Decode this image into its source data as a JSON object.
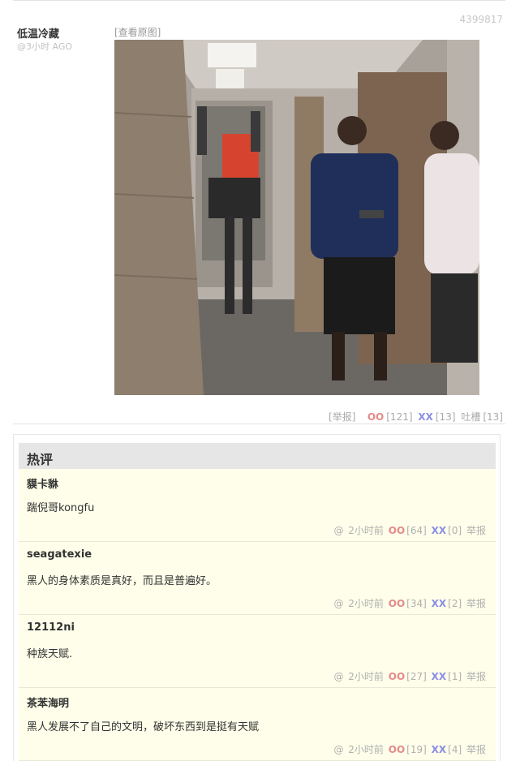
{
  "post": {
    "id": "4399817",
    "author": "低温冷藏",
    "time": "@3小时 AGO",
    "view_original": "[查看原图]",
    "report": "[举报]",
    "oo_label": "OO",
    "oo_count": "[121]",
    "xx_label": "XX",
    "xx_count": "[13]",
    "tucao_label": "吐槽",
    "tucao_count": "[13]"
  },
  "hot_comments": {
    "title": "热评",
    "items": [
      {
        "author": "貘卡貅",
        "text": "踹倪哥kongfu",
        "at": "@",
        "time": "2小时前",
        "oo": "OO",
        "oo_count": "[64]",
        "xx": "XX",
        "xx_count": "[0]",
        "report": "举报"
      },
      {
        "author": "seagatexie",
        "text": "黑人的身体素质是真好，而且是普遍好。",
        "at": "@",
        "time": "2小时前",
        "oo": "OO",
        "oo_count": "[34]",
        "xx": "XX",
        "xx_count": "[2]",
        "report": "举报"
      },
      {
        "author": "12112ni",
        "text": "种族天赋.",
        "at": "@",
        "time": "2小时前",
        "oo": "OO",
        "oo_count": "[27]",
        "xx": "XX",
        "xx_count": "[1]",
        "report": "举报"
      },
      {
        "author": "茶苯海明",
        "text": "黑人发展不了自己的文明，破坏东西到是挺有天赋",
        "at": "@",
        "time": "2小时前",
        "oo": "OO",
        "oo_count": "[19]",
        "xx": "XX",
        "xx_count": "[4]",
        "report": "举报"
      }
    ]
  },
  "colors": {
    "oo": "#e58a8a",
    "xx": "#8a8ee5",
    "comment_bg": "#fefeea",
    "header_bg": "#e6e6e6"
  }
}
